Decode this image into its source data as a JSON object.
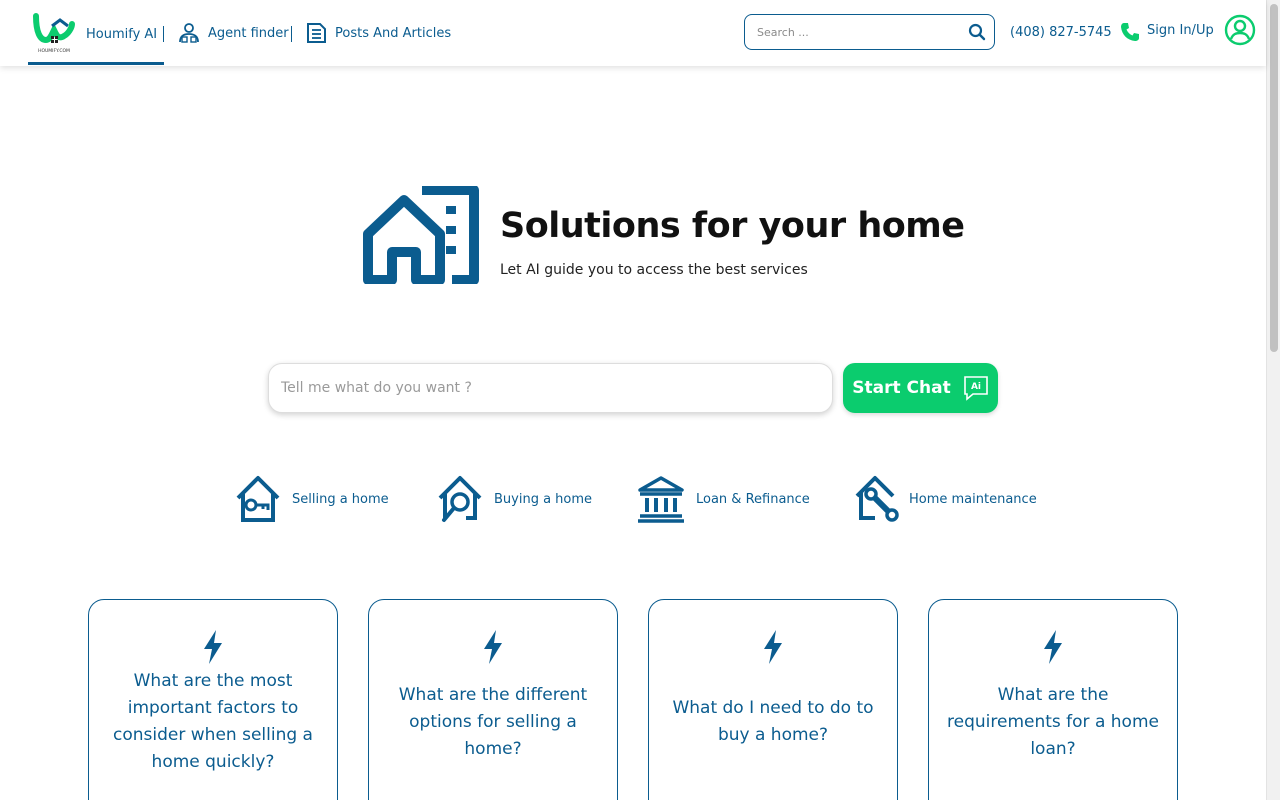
{
  "brand": {
    "name": "Houmify AI",
    "logo_text": "HOUMIFY.COM",
    "primary_color": "#0b5c8f",
    "accent_color": "#0bcc6e"
  },
  "nav": {
    "agent_finder": "Agent finder",
    "posts": "Posts And Articles"
  },
  "search": {
    "placeholder": "Search ..."
  },
  "contact": {
    "phone": "(408) 827-5745"
  },
  "auth": {
    "sign_in": "Sign In/Up"
  },
  "hero": {
    "title": "Solutions for your home",
    "subtitle": "Let AI guide you to access the best services"
  },
  "chat": {
    "placeholder": "Tell me what do you want ?",
    "button_label": "Start Chat",
    "button_badge": "Ai"
  },
  "categories": [
    {
      "label": "Selling a home",
      "icon": "house-key-icon"
    },
    {
      "label": "Buying a home",
      "icon": "house-search-icon"
    },
    {
      "label": "Loan & Refinance",
      "icon": "bank-icon"
    },
    {
      "label": "Home maintenance",
      "icon": "house-wrench-icon"
    }
  ],
  "questions": [
    {
      "text": "What are the most important factors to consider when selling a home quickly?"
    },
    {
      "text": "What are the different options for selling a home?"
    },
    {
      "text": "What do I need to do to buy a home?"
    },
    {
      "text": "What are the requirements for a home loan?"
    }
  ]
}
